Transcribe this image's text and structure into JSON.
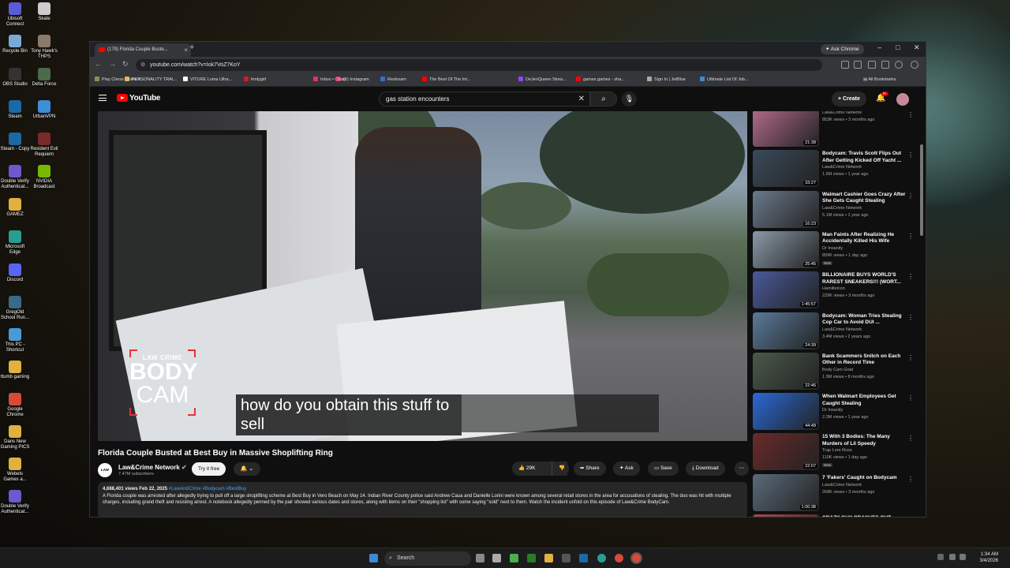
{
  "desktop": {
    "icons": [
      {
        "label": "Ubisoft Connect",
        "color": "#5b5bd6"
      },
      {
        "label": "Skate",
        "color": "#ccc"
      },
      {
        "label": "Recycle Bin",
        "color": "#7aa9d6"
      },
      {
        "label": "Tony Hawk's THPS",
        "color": "#8a7a6a"
      },
      {
        "label": "OBS Studio",
        "color": "#333"
      },
      {
        "label": "Delta Force",
        "color": "#4a6a4a"
      },
      {
        "label": "Steam",
        "color": "#1b6aa5"
      },
      {
        "label": "UrbanVPN",
        "color": "#3a8fd6"
      },
      {
        "label": "Steam - Copy",
        "color": "#1b6aa5"
      },
      {
        "label": "Resident Evil Requiem",
        "color": "#7a2a2a"
      },
      {
        "label": "Double Verify Authenticat...",
        "color": "#6a5acd"
      },
      {
        "label": "NVIDIA Broadcast",
        "color": "#76b900"
      },
      {
        "label": "GAMEZ",
        "color": "#e0b040"
      },
      {
        "label": "Microsoft Edge",
        "color": "#2a9d8f"
      },
      {
        "label": "Discord",
        "color": "#5865f2"
      },
      {
        "label": "GregOld School Run...",
        "color": "#3a6a8a"
      },
      {
        "label": "This PC - Shortcut",
        "color": "#4a9ad6"
      },
      {
        "label": "ttumb gaming",
        "color": "#e0b040"
      },
      {
        "label": "Google Chrome",
        "color": "#d64a3a"
      },
      {
        "label": "Dans New Gaming PICS",
        "color": "#e0b040"
      },
      {
        "label": "Webels Games a...",
        "color": "#e0b040"
      },
      {
        "label": "Double Verify Authenticat...",
        "color": "#6a5acd"
      }
    ]
  },
  "browser": {
    "tab_title": "(179) Florida Couple Buste...",
    "ask_chrome": "Ask Chrome",
    "url": "youtube.com/watch?v=Iok7VoZ7KoY",
    "bookmarks": [
      {
        "label": "Play Chess Online f...",
        "color": "#7a9a4a"
      },
      {
        "label": "PERSONALITY TRAI...",
        "color": "#e0b040"
      },
      {
        "label": "VITURE Luma Ultra...",
        "color": "#fff"
      },
      {
        "label": "fentygirl",
        "color": "#c22"
      },
      {
        "label": "Inbox • Chats",
        "color": "#e1306c"
      },
      {
        "label": "(1) Instagram",
        "color": "#e1306c"
      },
      {
        "label": "Restream",
        "color": "#3a6ad6"
      },
      {
        "label": "The Best Of The Int...",
        "color": "#f00"
      },
      {
        "label": "DeJenQueen Strea...",
        "color": "#9146ff"
      },
      {
        "label": "games games - sha...",
        "color": "#f00"
      },
      {
        "label": "Sign In | JetBlue",
        "color": "#aaa"
      },
      {
        "label": "Ultimate List Of Job...",
        "color": "#3a8ad6"
      }
    ],
    "all_bookmarks": "All Bookmarks"
  },
  "youtube": {
    "logo_text": "YouTube",
    "search_query": "gas station encounters",
    "create_label": "Create",
    "notifications_count": "9+",
    "video": {
      "overlay_brand_top": "LAW CRIME",
      "overlay_brand_mid": "BODY",
      "overlay_brand_bottom": "CAM",
      "subtitle": "how do you obtain this stuff to\nsell",
      "title": "Florida Couple Busted at Best Buy in Massive Shoplifting Ring",
      "channel_name": "Law&Crime Network",
      "channel_avatar_text": "LAW CRIME",
      "subscribers": "7.47M subscribers",
      "try_free": "Try it free",
      "likes": "29K",
      "share": "Share",
      "ask": "Ask",
      "save": "Save",
      "download": "Download",
      "views_date": "4,688,401 views  Feb 22, 2025",
      "hashtags": "#LawAndCrime #Bodycam #BestBuy",
      "description": "A Florida couple was arrested after allegedly trying to pull off a large shoplifting scheme at Best Buy in Vero Beach on May 14. Indian River County police said Andrew Caua and Danielle Lorini were known among several retail stores in the area for accusations of stealing. The duo was hit with multiple charges, including grand theft and resisting arrest. A notebook allegedly penned by the pair showed various dates and stores, along with items on their \"shopping list\" with some saying \"sold\" next to them. Watch the incident unfold on this episode of Law&Crime BodyCam."
    },
    "related": [
      {
        "title": "",
        "channel": "Law&Crime Network",
        "meta": "853K views • 3 months ago",
        "duration": "21:38",
        "thumb": "#b06a8a",
        "new": ""
      },
      {
        "title": "Bodycam: Travis Scott Flips Out After Getting Kicked Off Yacht ...",
        "channel": "Law&Crime Network",
        "meta": "1.6M views • 1 year ago",
        "duration": "33:27",
        "thumb": "#3a4a5a",
        "new": ""
      },
      {
        "title": "Walmart Cashier Goes Crazy After She Gets Caught Stealing",
        "channel": "Law&Crime Network",
        "meta": "5.1M views • 1 year ago",
        "duration": "16:23",
        "thumb": "#6a7a8a",
        "new": ""
      },
      {
        "title": "Man Faints After Realizing He Accidentally Killed His Wife",
        "channel": "Dr Insanity",
        "meta": "899K views • 1 day ago",
        "duration": "25:45",
        "thumb": "#8a9aaa",
        "new": "New"
      },
      {
        "title": "BILLIONAIRE BUYS WORLD'S RAREST SNEAKERS!!! (WORT...",
        "channel": "Hamiltelcon",
        "meta": "229K views • 3 months ago",
        "duration": "1:45:57",
        "thumb": "#4a5a9a",
        "new": ""
      },
      {
        "title": "Bodycam: Woman Tries Stealing Cop Car to Avoid DUI ...",
        "channel": "Law&Crime Network",
        "meta": "3.4M views • 2 years ago",
        "duration": "24:39",
        "thumb": "#5a7a9a",
        "new": ""
      },
      {
        "title": "Bank Scammers Snitch on Each Other in Record Time",
        "channel": "Body Cam Goat",
        "meta": "1.9M views • 8 months ago",
        "duration": "22:46",
        "thumb": "#4a5a4a",
        "new": ""
      },
      {
        "title": "When Walmart Employees Get Caught Stealing",
        "channel": "Dr Insanity",
        "meta": "2.3M views • 1 year ago",
        "duration": "44:48",
        "thumb": "#2a6ad6",
        "new": ""
      },
      {
        "title": "15 With 3 Bodies: The Many Murders of Lil Speedy",
        "channel": "Trap Lore Ross",
        "meta": "110K views • 1 day ago",
        "duration": "22:07",
        "thumb": "#6a2a2a",
        "new": "New"
      },
      {
        "title": "7 'Fakers' Caught on Bodycam",
        "channel": "Law&Crime Network",
        "meta": "268K views • 3 months ago",
        "duration": "1:00:38",
        "thumb": "#5a6a7a",
        "new": ""
      },
      {
        "title": "CRAZY GUY CRASHES OUT...",
        "channel": "",
        "meta": "",
        "duration": "",
        "thumb": "#aa4a4a",
        "new": ""
      }
    ]
  },
  "taskbar": {
    "search_label": "Search",
    "time": "1:34 AM",
    "date": "3/4/2026"
  }
}
